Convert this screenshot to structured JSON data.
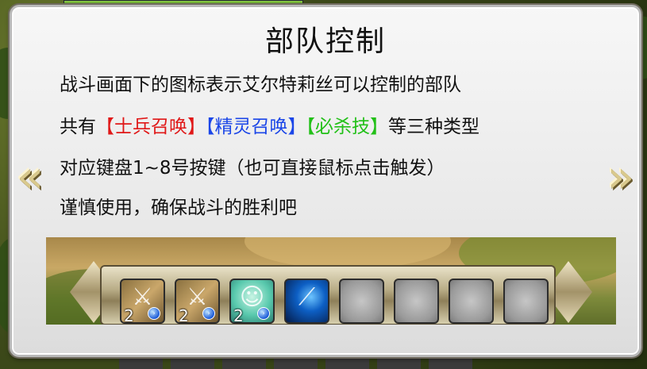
{
  "dialog": {
    "title": "部队控制",
    "line1": "战斗画面下的图标表示艾尔特莉丝可以控制的部队",
    "line2": {
      "prefix": "共有",
      "lb1": "【",
      "type1": "士兵召唤",
      "rb1": "】",
      "lb2": "【",
      "type2": "精灵召唤",
      "rb2": "】",
      "lb3": "【",
      "type3": "必杀技",
      "rb3": "】",
      "suffix": "等三种类型"
    },
    "line3": "对应键盘1~8号按键（也可直接鼠标点击触发）",
    "line4": "谨慎使用，确保战斗的胜利吧",
    "colors": {
      "soldier": "#e01818",
      "spirit": "#1b46e8",
      "special": "#22c018"
    }
  },
  "nav": {
    "prev_arrow": "«",
    "next_arrow": "»",
    "prev_icon": "chevron-left-icon",
    "next_icon": "chevron-right-icon"
  },
  "preview": {
    "slots": [
      {
        "type": "soldier",
        "icon": "swords-icon",
        "count": "2"
      },
      {
        "type": "soldier",
        "icon": "swords-icon",
        "count": "2"
      },
      {
        "type": "spirit",
        "icon": "spirit-girl-icon",
        "count": "2"
      },
      {
        "type": "special",
        "icon": "blue-slash-icon",
        "count": ""
      },
      {
        "type": "empty",
        "icon": "",
        "count": ""
      },
      {
        "type": "empty",
        "icon": "",
        "count": ""
      },
      {
        "type": "empty",
        "icon": "",
        "count": ""
      },
      {
        "type": "empty",
        "icon": "",
        "count": ""
      }
    ]
  }
}
